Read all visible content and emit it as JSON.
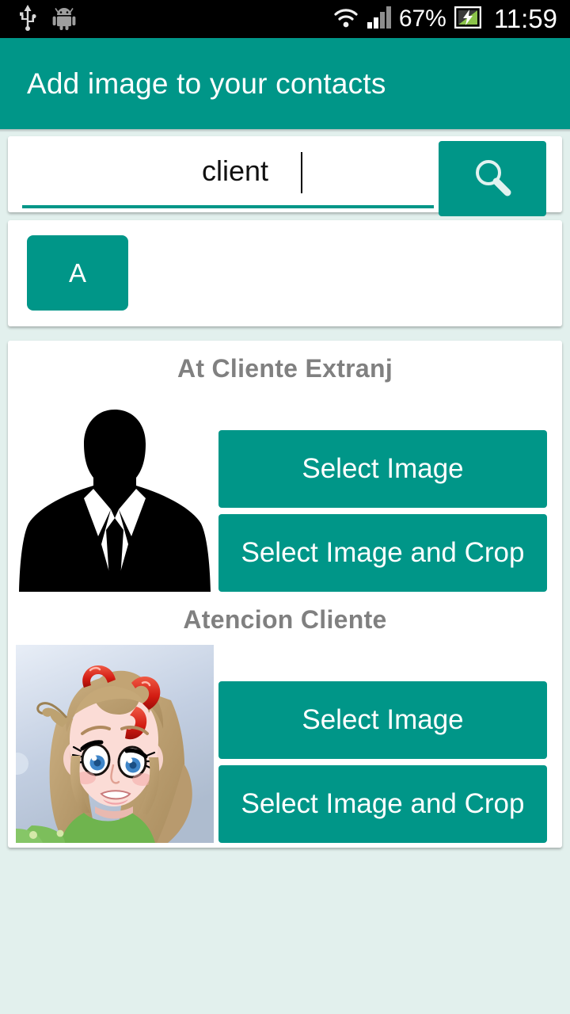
{
  "status_bar": {
    "icons_left": [
      "usb-icon",
      "android-robot-icon"
    ],
    "icons_right": [
      "wifi-icon",
      "signal-icon",
      "battery-charging-icon"
    ],
    "battery_percent": "67%",
    "time": "11:59"
  },
  "action_bar": {
    "title": "Add image to your contacts",
    "background_color": "#009688"
  },
  "search": {
    "value": "client",
    "placeholder": "",
    "button_icon": "search-icon"
  },
  "alphabet_index": {
    "items": [
      {
        "label": "A"
      }
    ]
  },
  "contacts": [
    {
      "name": "At Cliente Extranj",
      "avatar_type": "silhouette-placeholder",
      "select_image_label": "Select Image",
      "select_crop_label": "Select Image and Crop"
    },
    {
      "name": "Atencion Cliente",
      "avatar_type": "anime-portrait-photo",
      "select_image_label": "Select Image",
      "select_crop_label": "Select Image and Crop"
    }
  ],
  "theme": {
    "accent": "#009688",
    "page_background": "#e2f0ed",
    "card_background": "#ffffff",
    "contact_name_color": "#808080"
  }
}
